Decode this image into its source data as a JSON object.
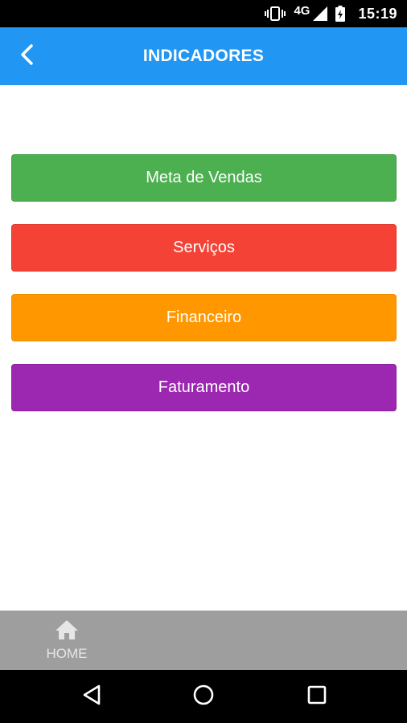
{
  "status_bar": {
    "network": "4G",
    "time": "15:19"
  },
  "app_bar": {
    "title": "INDICADORES",
    "back_icon": "chevron-left-icon",
    "color": "#2196f3"
  },
  "menu": {
    "items": [
      {
        "label": "Meta de Vendas",
        "color": "#4caf50"
      },
      {
        "label": "Serviços",
        "color": "#f44336"
      },
      {
        "label": "Financeiro",
        "color": "#ff9800"
      },
      {
        "label": "Faturamento",
        "color": "#9c27b0"
      }
    ]
  },
  "bottom_tabs": {
    "home": {
      "label": "HOME",
      "icon": "home-icon"
    }
  },
  "nav_bar": {
    "icons": [
      "back-triangle-icon",
      "home-circle-icon",
      "recent-apps-icon"
    ]
  }
}
